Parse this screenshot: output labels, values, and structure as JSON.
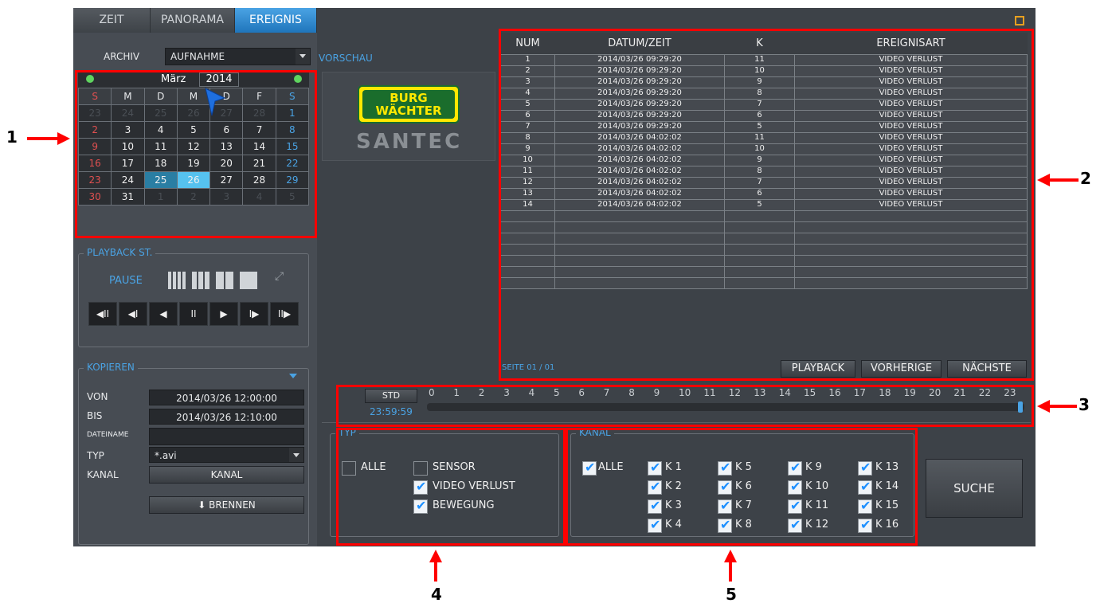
{
  "tabs": [
    {
      "label": "ZEIT"
    },
    {
      "label": "PANORAMA"
    },
    {
      "label": "EREIGNIS"
    }
  ],
  "archive": {
    "label": "ARCHIV",
    "value": "AUFNAHME"
  },
  "calendar": {
    "month": "März",
    "year": "2014",
    "weekdays": [
      "S",
      "M",
      "D",
      "M",
      "D",
      "F",
      "S"
    ],
    "rows": [
      [
        "23",
        "24",
        "25",
        "26",
        "27",
        "28",
        "1"
      ],
      [
        "2",
        "3",
        "4",
        "5",
        "6",
        "7",
        "8"
      ],
      [
        "9",
        "10",
        "11",
        "12",
        "13",
        "14",
        "15"
      ],
      [
        "16",
        "17",
        "18",
        "19",
        "20",
        "21",
        "22"
      ],
      [
        "23",
        "24",
        "25",
        "26",
        "27",
        "28",
        "29"
      ],
      [
        "30",
        "31",
        "1",
        "2",
        "3",
        "4",
        "5"
      ]
    ]
  },
  "playback": {
    "title": "PLAYBACK ST.",
    "state": "PAUSE",
    "buttons": [
      "◀II",
      "◀I",
      "◀",
      "II",
      "▶",
      "I▶",
      "II▶"
    ]
  },
  "copy": {
    "title": "KOPIEREN",
    "from_label": "VON",
    "from": "2014/03/26 12:00:00",
    "to_label": "BIS",
    "to": "2014/03/26 12:10:00",
    "filename_label": "DATEINAME",
    "filename": "",
    "type_label": "TYP",
    "type": "*.avi",
    "channel_label": "KANAL",
    "channel_button": "KANAL",
    "burn_button": "BRENNEN"
  },
  "preview": {
    "label": "VORSCHAU",
    "logo_line1": "BURG",
    "logo_line2": "WÄCHTER",
    "brand": "SANTEC"
  },
  "events": {
    "headers": [
      "NUM",
      "DATUM/ZEIT",
      "K",
      "EREIGNISART"
    ],
    "rows": [
      [
        "1",
        "2014/03/26 09:29:20",
        "11",
        "VIDEO VERLUST"
      ],
      [
        "2",
        "2014/03/26 09:29:20",
        "10",
        "VIDEO VERLUST"
      ],
      [
        "3",
        "2014/03/26 09:29:20",
        "9",
        "VIDEO VERLUST"
      ],
      [
        "4",
        "2014/03/26 09:29:20",
        "8",
        "VIDEO VERLUST"
      ],
      [
        "5",
        "2014/03/26 09:29:20",
        "7",
        "VIDEO VERLUST"
      ],
      [
        "6",
        "2014/03/26 09:29:20",
        "6",
        "VIDEO VERLUST"
      ],
      [
        "7",
        "2014/03/26 09:29:20",
        "5",
        "VIDEO VERLUST"
      ],
      [
        "8",
        "2014/03/26 04:02:02",
        "11",
        "VIDEO VERLUST"
      ],
      [
        "9",
        "2014/03/26 04:02:02",
        "10",
        "VIDEO VERLUST"
      ],
      [
        "10",
        "2014/03/26 04:02:02",
        "9",
        "VIDEO VERLUST"
      ],
      [
        "11",
        "2014/03/26 04:02:02",
        "8",
        "VIDEO VERLUST"
      ],
      [
        "12",
        "2014/03/26 04:02:02",
        "7",
        "VIDEO VERLUST"
      ],
      [
        "13",
        "2014/03/26 04:02:02",
        "6",
        "VIDEO VERLUST"
      ],
      [
        "14",
        "2014/03/26 04:02:02",
        "5",
        "VIDEO VERLUST"
      ]
    ],
    "page": "SEITE 01 / 01",
    "playback_button": "PLAYBACK",
    "prev_button": "VORHERIGE",
    "next_button": "NÄCHSTE"
  },
  "timeline": {
    "std_button": "STD",
    "time": "23:59:59",
    "hours": [
      "0",
      "1",
      "2",
      "3",
      "4",
      "5",
      "6",
      "7",
      "8",
      "9",
      "10",
      "11",
      "12",
      "13",
      "14",
      "15",
      "16",
      "17",
      "18",
      "19",
      "20",
      "21",
      "22",
      "23"
    ]
  },
  "filter_type": {
    "title": "TYP",
    "all": "ALLE",
    "sensor": "SENSOR",
    "video_loss": "VIDEO VERLUST",
    "motion": "BEWEGUNG"
  },
  "filter_channel": {
    "title": "KANAL",
    "all": "ALLE",
    "channels": [
      "K 1",
      "K 2",
      "K 3",
      "K 4",
      "K 5",
      "K 6",
      "K 7",
      "K 8",
      "K 9",
      "K 10",
      "K 11",
      "K 12",
      "K 13",
      "K 14",
      "K 15",
      "K 16"
    ]
  },
  "search_button": "SUCHE",
  "callouts": [
    "1",
    "2",
    "3",
    "4",
    "5"
  ],
  "colors": {
    "accent": "#4aa3e4",
    "annotation": "#ff0000",
    "panel": "#3d4248"
  }
}
